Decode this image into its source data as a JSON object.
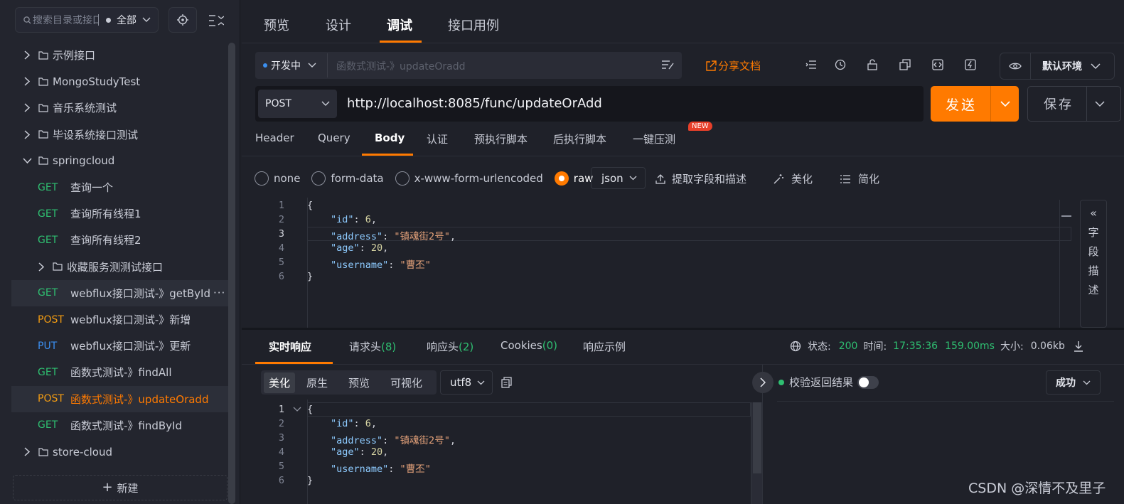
{
  "sidebar": {
    "search_placeholder": "搜索目录或接口",
    "filter_label": "全部",
    "tree": [
      {
        "type": "folder",
        "label": "示例接口",
        "expanded": false
      },
      {
        "type": "folder",
        "label": "MongoStudyTest",
        "expanded": false
      },
      {
        "type": "folder",
        "label": "音乐系统测试",
        "expanded": false
      },
      {
        "type": "folder",
        "label": "毕设系统接口测试",
        "expanded": false
      },
      {
        "type": "folder",
        "label": "springcloud",
        "expanded": true
      },
      {
        "type": "api",
        "method": "GET",
        "label": "查询一个"
      },
      {
        "type": "api",
        "method": "GET",
        "label": "查询所有线程1"
      },
      {
        "type": "api",
        "method": "GET",
        "label": "查询所有线程2"
      },
      {
        "type": "folder",
        "label": "收藏服务测测试接口",
        "expanded": false
      },
      {
        "type": "api",
        "method": "GET",
        "label": "webflux接口测试-》getById",
        "more": "···"
      },
      {
        "type": "api",
        "method": "POST",
        "label": "webflux接口测试-》新增"
      },
      {
        "type": "api",
        "method": "PUT",
        "label": "webflux接口测试-》更新"
      },
      {
        "type": "api",
        "method": "GET",
        "label": "函数式测试-》findAll"
      },
      {
        "type": "api",
        "method": "POST",
        "label": "函数式测试-》updateOradd",
        "active": true
      },
      {
        "type": "api",
        "method": "GET",
        "label": "函数式测试-》findById"
      },
      {
        "type": "folder",
        "label": "store-cloud",
        "expanded": false
      }
    ],
    "new_label": "新建"
  },
  "top_tabs": [
    "预览",
    "设计",
    "调试",
    "接口用例"
  ],
  "active_top_tab": "调试",
  "toolbar": {
    "status": "开发中",
    "name_placeholder": "函数式测试-》updateOradd",
    "share": "分享文档",
    "env": "默认环境"
  },
  "request": {
    "method": "POST",
    "url": "http://localhost:8085/func/updateOrAdd",
    "send": "发送",
    "save": "保存"
  },
  "req_tabs": [
    "Header",
    "Query",
    "Body",
    "认证",
    "预执行脚本",
    "后执行脚本",
    "一键压测"
  ],
  "new_badge": "NEW",
  "body_modes": [
    "none",
    "form-data",
    "x-www-form-urlencoded",
    "raw"
  ],
  "body_format": "json",
  "body_actions": [
    "提取字段和描述",
    "美化",
    "简化"
  ],
  "side_panel": [
    "字",
    "段",
    "描",
    "述"
  ],
  "request_body": {
    "id": "6",
    "address": "镇魂街2号",
    "age": "20",
    "username": "曹丕"
  },
  "resp_tabs": [
    {
      "label": "实时响应",
      "count": ""
    },
    {
      "label": "请求头",
      "count": "(8)"
    },
    {
      "label": "响应头",
      "count": "(2)"
    },
    {
      "label": "Cookies",
      "count": "(0)"
    },
    {
      "label": "响应示例",
      "count": ""
    }
  ],
  "resp_status": {
    "status_label": "状态:",
    "status": "200",
    "time_label": "时间:",
    "time": "17:35:36",
    "duration": "159.00ms",
    "size_label": "大小:",
    "size": "0.06kb"
  },
  "resp_views": [
    "美化",
    "原生",
    "预览",
    "可视化"
  ],
  "resp_encoding": "utf8",
  "validate_label": "校验返回结果",
  "result_select": "成功",
  "watermark": "CSDN @深情不及里子",
  "colors": {
    "accent": "#ff7a00",
    "green": "#2fbf71",
    "blue": "#3b8ff0"
  }
}
